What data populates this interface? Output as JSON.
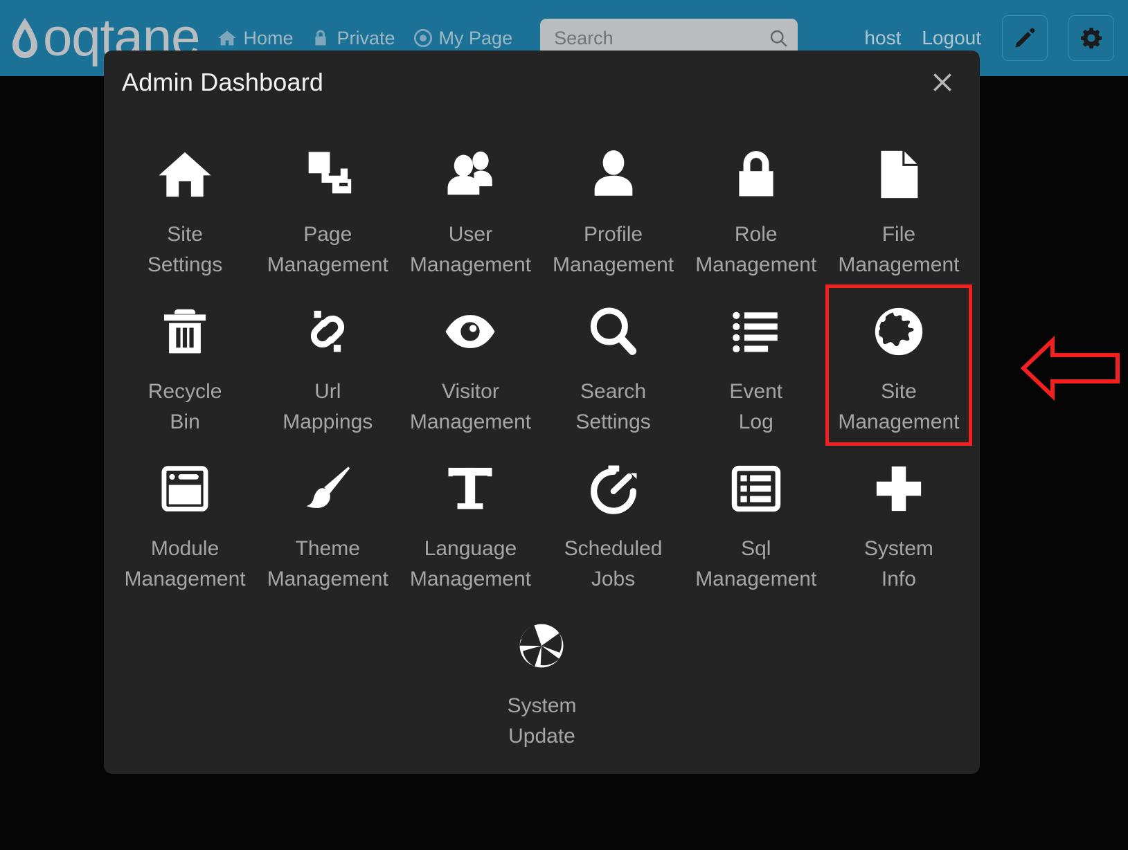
{
  "header": {
    "brand": "oqtane",
    "brand_icon": "water-drop-icon",
    "nav": [
      {
        "label": "Home",
        "icon": "home-icon"
      },
      {
        "label": "Private",
        "icon": "lock-icon"
      },
      {
        "label": "My Page",
        "icon": "target-icon"
      }
    ],
    "search": {
      "placeholder": "Search",
      "value": "",
      "icon": "search-icon"
    },
    "user": "host",
    "logout": "Logout",
    "edit_icon": "pencil-icon",
    "settings_icon": "gear-icon"
  },
  "modal": {
    "title": "Admin Dashboard",
    "close_icon": "close-icon",
    "tiles": [
      {
        "label": "Site\nSettings",
        "icon": "home-icon",
        "highlighted": false
      },
      {
        "label": "Page\nManagement",
        "icon": "pages-icon",
        "highlighted": false
      },
      {
        "label": "User\nManagement",
        "icon": "users-icon",
        "highlighted": false
      },
      {
        "label": "Profile\nManagement",
        "icon": "person-icon",
        "highlighted": false
      },
      {
        "label": "Role\nManagement",
        "icon": "lock-icon",
        "highlighted": false
      },
      {
        "label": "File\nManagement",
        "icon": "file-icon",
        "highlighted": false
      },
      {
        "label": "Recycle\nBin",
        "icon": "trash-icon",
        "highlighted": false
      },
      {
        "label": "Url\nMappings",
        "icon": "broken-link-icon",
        "highlighted": false
      },
      {
        "label": "Visitor\nManagement",
        "icon": "eye-icon",
        "highlighted": false
      },
      {
        "label": "Search\nSettings",
        "icon": "search-icon",
        "highlighted": false
      },
      {
        "label": "Event\nLog",
        "icon": "list-icon",
        "highlighted": false
      },
      {
        "label": "Site\nManagement",
        "icon": "globe-icon",
        "highlighted": true
      },
      {
        "label": "Module\nManagement",
        "icon": "window-icon",
        "highlighted": false
      },
      {
        "label": "Theme\nManagement",
        "icon": "paintbrush-icon",
        "highlighted": false
      },
      {
        "label": "Language\nManagement",
        "icon": "text-t-icon",
        "highlighted": false
      },
      {
        "label": "Scheduled\nJobs",
        "icon": "stopwatch-icon",
        "highlighted": false
      },
      {
        "label": "Sql\nManagement",
        "icon": "table-icon",
        "highlighted": false
      },
      {
        "label": "System\nInfo",
        "icon": "plus-cross-icon",
        "highlighted": false
      },
      {
        "label": "System\nUpdate",
        "icon": "aperture-icon",
        "highlighted": false
      }
    ]
  },
  "annotation": {
    "arrow_icon": "left-arrow-annotation",
    "highlight_color": "#f42020",
    "target": "Site Management"
  },
  "colors": {
    "header_background": "#1b7296",
    "modal_background": "#242424",
    "page_background": "#050505",
    "accent_red": "#f42020"
  }
}
